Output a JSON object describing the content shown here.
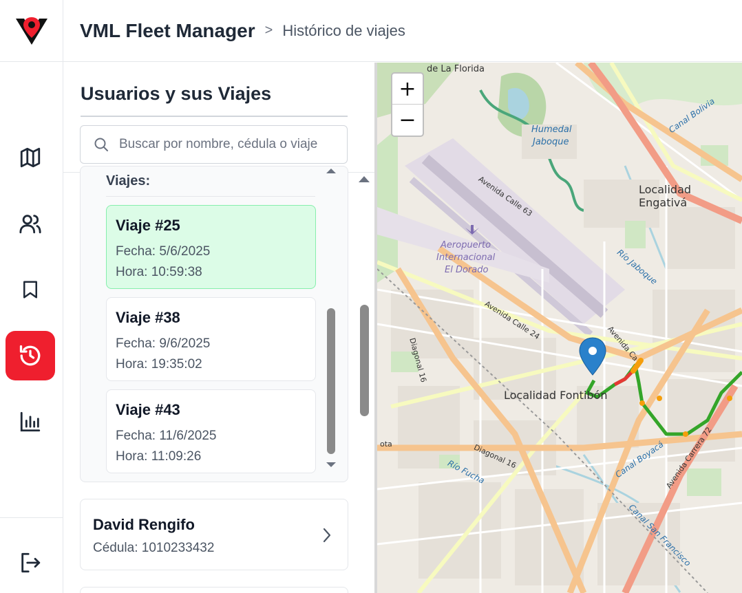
{
  "header": {
    "app_title": "VML Fleet Manager",
    "separator": ">",
    "breadcrumb": "Histórico de viajes"
  },
  "sidebar": {
    "items": [
      {
        "name": "map",
        "icon": "map-icon",
        "active": false
      },
      {
        "name": "users",
        "icon": "users-icon",
        "active": false
      },
      {
        "name": "saved",
        "icon": "bookmark-icon",
        "active": false
      },
      {
        "name": "history",
        "icon": "history-icon",
        "active": true
      },
      {
        "name": "stats",
        "icon": "bar-chart-icon",
        "active": false
      }
    ],
    "logout_icon": "logout-icon",
    "active_color": "#ef1f2e"
  },
  "panel": {
    "title": "Usuarios y sus Viajes",
    "search_placeholder": "Buscar por nombre, cédula o viaje",
    "trips_label": "Viajes:",
    "trips": [
      {
        "name": "Viaje #25",
        "fecha": "Fecha: 5/6/2025",
        "hora": "Hora: 10:59:38",
        "selected": true
      },
      {
        "name": "Viaje #38",
        "fecha": "Fecha: 9/6/2025",
        "hora": "Hora: 19:35:02",
        "selected": false
      },
      {
        "name": "Viaje #43",
        "fecha": "Fecha: 11/6/2025",
        "hora": "Hora: 11:09:26",
        "selected": false
      }
    ],
    "users": [
      {
        "name": "David Rengifo",
        "cedula": "Cédula: 1010233432"
      }
    ]
  },
  "map": {
    "zoom_in": "+",
    "zoom_out": "−",
    "labels": {
      "la_florida": "de La Florida",
      "humedal": "Humedal",
      "jaboque": "Jaboque",
      "canal_bolivia": "Canal Bolivia",
      "engativa": "Localidad Engativá",
      "calle63": "Avenida Calle 63",
      "aeropuerto1": "Aeropuerto",
      "aeropuerto2": "Internacional",
      "aeropuerto3": "El Dorado",
      "rio_jaboque": "Río Jaboque",
      "calle24": "Avenida Calle 24",
      "avenida_c": "Avenida Ca",
      "diagonal16a": "Diagonal 16",
      "fontibon": "Localidad Fontibón",
      "diagonal16b": "Diagonal 16",
      "rio_fucha": "Río Fucha",
      "canal_boyaca": "Canal Boyacá",
      "carrera72": "Avenida Carrera 72",
      "canal_sf": "Canal San Francisco",
      "ota": "ota"
    },
    "route_colors": {
      "green": "#34a529",
      "orange": "#f59e0b",
      "red": "#e53935"
    },
    "marker_color": "#2a81cb"
  }
}
